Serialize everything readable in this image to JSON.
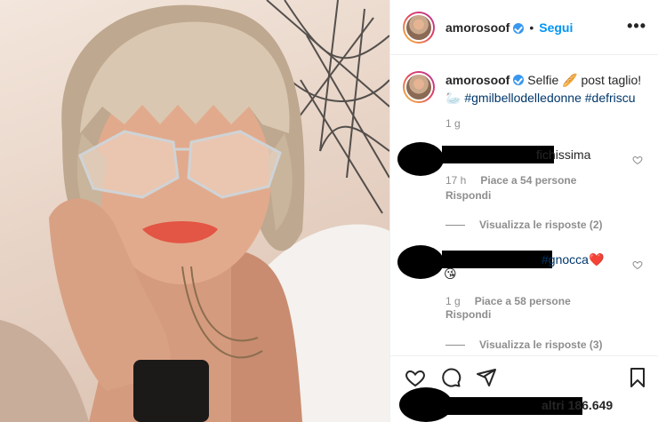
{
  "post": {
    "username": "amorosoof",
    "dot": "•",
    "follow_label": "Segui",
    "more_label": "•••"
  },
  "caption": {
    "username": "amorosoof",
    "text_a": "Selfie 🥖 post taglio!",
    "text_b": "🦢 ",
    "hashtags": "#gmilbellodelledonne #defriscu",
    "time": "1 g"
  },
  "comments": [
    {
      "text_tail": "fichissima",
      "time": "17 h",
      "likes": "Piace a 54 persone",
      "reply_label": "Rispondi",
      "view_replies": "Visualizza le risposte (2)"
    },
    {
      "hashtag": "#gnocca",
      "emoji_heart": "❤️",
      "emoji_kiss": "😘",
      "time": "1 g",
      "likes": "Piace a 58 persone",
      "reply_label": "Rispondi",
      "view_replies": "Visualizza le risposte (3)"
    }
  ],
  "likes_summary": {
    "text": "altri 186.649"
  },
  "icons": [
    "heart-icon",
    "comment-icon",
    "share-icon",
    "save-icon",
    "verified-badge-icon",
    "more-options-icon"
  ],
  "colors": {
    "link_blue": "#0095f6",
    "hashtag_blue": "#00376b",
    "verified_blue": "#3897f0",
    "muted_gray": "#8e8e8e",
    "text_dark": "#262626",
    "lips": "#e35544"
  }
}
